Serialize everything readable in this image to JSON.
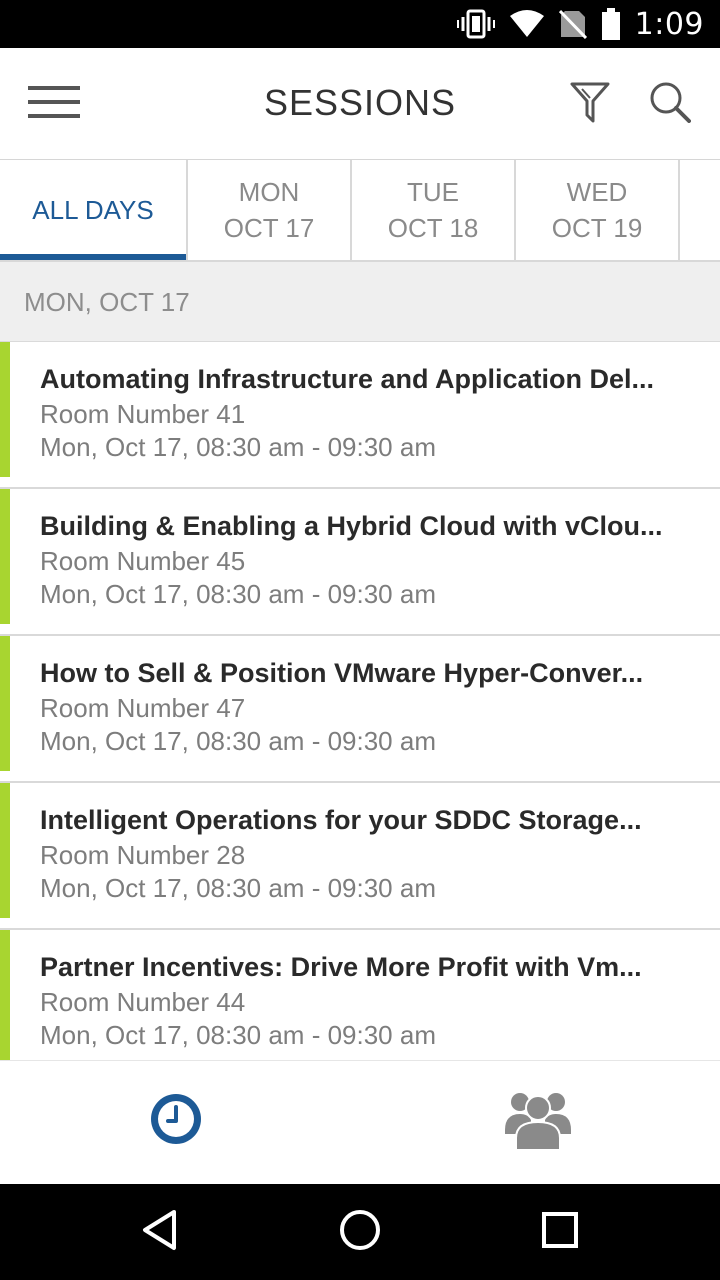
{
  "status_bar": {
    "time": "1:09",
    "icons": [
      "vibrate-icon",
      "wifi-icon",
      "no-sim-icon",
      "battery-icon"
    ]
  },
  "app_bar": {
    "title": "SESSIONS",
    "icons": [
      "hamburger-menu-icon",
      "filter-icon",
      "search-icon"
    ]
  },
  "day_tabs": [
    {
      "line1": "ALL DAYS",
      "line2": "",
      "selected": true
    },
    {
      "line1": "MON",
      "line2": "OCT 17",
      "selected": false
    },
    {
      "line1": "TUE",
      "line2": "OCT 18",
      "selected": false
    },
    {
      "line1": "WED",
      "line2": "OCT 19",
      "selected": false
    }
  ],
  "section_header": "MON, OCT 17",
  "sessions": [
    {
      "title": "Automating Infrastructure and Application Del...",
      "room": "Room Number 41",
      "time": "Mon, Oct 17, 08:30 am - 09:30 am"
    },
    {
      "title": "Building & Enabling a Hybrid Cloud with vClou...",
      "room": "Room Number 45",
      "time": "Mon, Oct 17, 08:30 am - 09:30 am"
    },
    {
      "title": "How to Sell & Position VMware Hyper-Conver...",
      "room": "Room Number 47",
      "time": "Mon, Oct 17, 08:30 am - 09:30 am"
    },
    {
      "title": "Intelligent Operations for your SDDC Storage...",
      "room": "Room Number 28",
      "time": "Mon, Oct 17, 08:30 am - 09:30 am"
    },
    {
      "title": "Partner Incentives:  Drive More Profit with Vm...",
      "room": "Room Number 44",
      "time": "Mon, Oct 17, 08:30 am - 09:30 am"
    }
  ],
  "bottom_nav": {
    "items": [
      {
        "icon": "clock-icon",
        "active": true
      },
      {
        "icon": "people-icon",
        "active": false
      }
    ]
  },
  "colors": {
    "accent_blue": "#1d5a96",
    "session_accent_green": "#a8d530",
    "inactive_gray": "#8a8a8a"
  }
}
